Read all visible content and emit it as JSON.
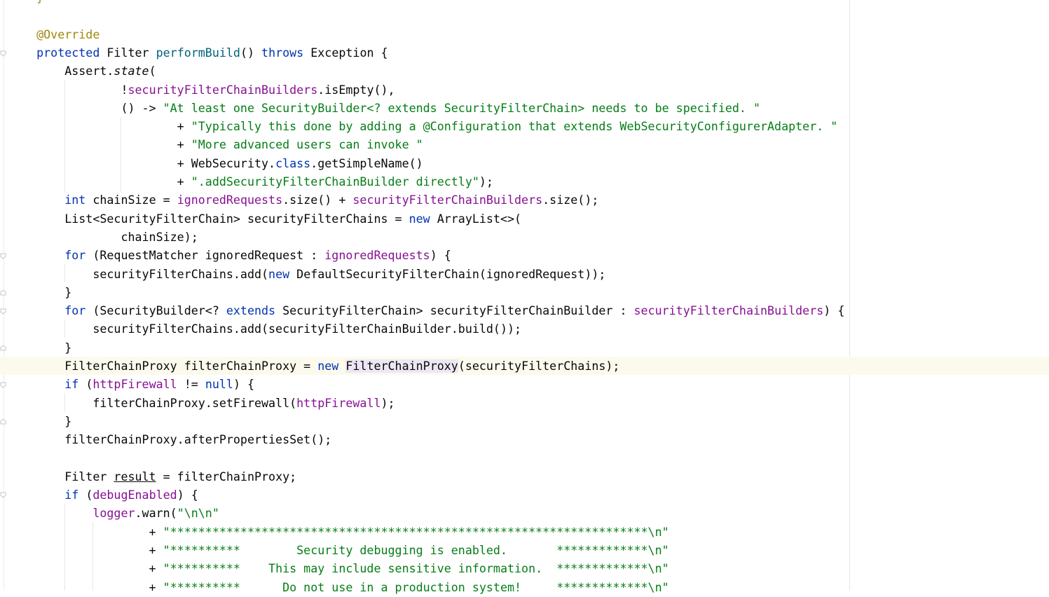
{
  "editor": {
    "language": "java",
    "lines": [
      [
        [
          "ann",
          "    }"
        ]
      ],
      [],
      [
        [
          "ann",
          "    @Override"
        ]
      ],
      [
        [
          "kw",
          "    protected "
        ],
        [
          "",
          "Filter "
        ],
        [
          "fn",
          "performBuild"
        ],
        [
          "",
          "() "
        ],
        [
          "kw",
          "throws "
        ],
        [
          "",
          "Exception {"
        ]
      ],
      [
        [
          "",
          "        Assert."
        ],
        [
          "it",
          "state"
        ],
        [
          "",
          "("
        ]
      ],
      [
        [
          "",
          "                !"
        ],
        [
          "fld",
          "securityFilterChainBuilders"
        ],
        [
          "",
          ".isEmpty(),"
        ]
      ],
      [
        [
          "",
          "                () -> "
        ],
        [
          "str",
          "\"At least one SecurityBuilder<? extends SecurityFilterChain> needs to be specified. \""
        ]
      ],
      [
        [
          "",
          "                        + "
        ],
        [
          "str",
          "\"Typically this done by adding a @Configuration that extends WebSecurityConfigurerAdapter. \""
        ]
      ],
      [
        [
          "",
          "                        + "
        ],
        [
          "str",
          "\"More advanced users can invoke \""
        ]
      ],
      [
        [
          "",
          "                        + WebSecurity."
        ],
        [
          "kw",
          "class"
        ],
        [
          "",
          ".getSimpleName()"
        ]
      ],
      [
        [
          "",
          "                        + "
        ],
        [
          "str",
          "\".addSecurityFilterChainBuilder directly\""
        ],
        [
          "",
          ");"
        ]
      ],
      [
        [
          "kw",
          "        int "
        ],
        [
          "",
          "chainSize = "
        ],
        [
          "fld",
          "ignoredRequests"
        ],
        [
          "",
          ".size() + "
        ],
        [
          "fld",
          "securityFilterChainBuilders"
        ],
        [
          "",
          ".size();"
        ]
      ],
      [
        [
          "",
          "        List<SecurityFilterChain> securityFilterChains = "
        ],
        [
          "kw",
          "new "
        ],
        [
          "",
          "ArrayList<>("
        ]
      ],
      [
        [
          "",
          "                chainSize);"
        ]
      ],
      [
        [
          "kw",
          "        for "
        ],
        [
          "",
          "(RequestMatcher ignoredRequest : "
        ],
        [
          "fld",
          "ignoredRequests"
        ],
        [
          "",
          ") {"
        ]
      ],
      [
        [
          "",
          "            securityFilterChains.add("
        ],
        [
          "kw",
          "new "
        ],
        [
          "",
          "DefaultSecurityFilterChain(ignoredRequest));"
        ]
      ],
      [
        [
          "",
          "        }"
        ]
      ],
      [
        [
          "kw",
          "        for "
        ],
        [
          "",
          "(SecurityBuilder<? "
        ],
        [
          "kw",
          "extends "
        ],
        [
          "",
          "SecurityFilterChain> securityFilterChainBuilder : "
        ],
        [
          "fld",
          "securityFilterChainBuilders"
        ],
        [
          "",
          ") {"
        ]
      ],
      [
        [
          "",
          "            securityFilterChains.add(securityFilterChainBuilder.build());"
        ]
      ],
      [
        [
          "",
          "        }"
        ]
      ],
      [
        [
          "",
          "        FilterChainProxy filterChainProxy = "
        ],
        [
          "kw",
          "new "
        ],
        [
          "hl",
          "FilterChainProxy"
        ],
        [
          "",
          "(securityFilterChains);"
        ]
      ],
      [
        [
          "kw",
          "        if "
        ],
        [
          "",
          "("
        ],
        [
          "fld",
          "httpFirewall "
        ],
        [
          "",
          "!= "
        ],
        [
          "kw",
          "null"
        ],
        [
          "",
          ") {"
        ]
      ],
      [
        [
          "",
          "            filterChainProxy.setFirewall("
        ],
        [
          "fld",
          "httpFirewall"
        ],
        [
          "",
          ");"
        ]
      ],
      [
        [
          "",
          "        }"
        ]
      ],
      [
        [
          "",
          "        filterChainProxy.afterPropertiesSet();"
        ]
      ],
      [],
      [
        [
          "",
          "        Filter "
        ],
        [
          "ul",
          "result"
        ],
        [
          "",
          " = filterChainProxy;"
        ]
      ],
      [
        [
          "kw",
          "        if "
        ],
        [
          "",
          "("
        ],
        [
          "fld",
          "debugEnabled"
        ],
        [
          "",
          ") {"
        ]
      ],
      [
        [
          "",
          "            "
        ],
        [
          "fld",
          "logger"
        ],
        [
          "",
          ".warn("
        ],
        [
          "str",
          "\"\\n\\n\""
        ]
      ],
      [
        [
          "",
          "                    + "
        ],
        [
          "str",
          "\"********************************************************************\\n\""
        ]
      ],
      [
        [
          "",
          "                    + "
        ],
        [
          "str",
          "\"**********        Security debugging is enabled.       *************\\n\""
        ]
      ],
      [
        [
          "",
          "                    + "
        ],
        [
          "str",
          "\"**********    This may include sensitive information.  *************\\n\""
        ]
      ],
      [
        [
          "",
          "                    + "
        ],
        [
          "str",
          "\"**********      Do not use in a production system!     *************\\n\""
        ]
      ]
    ]
  }
}
